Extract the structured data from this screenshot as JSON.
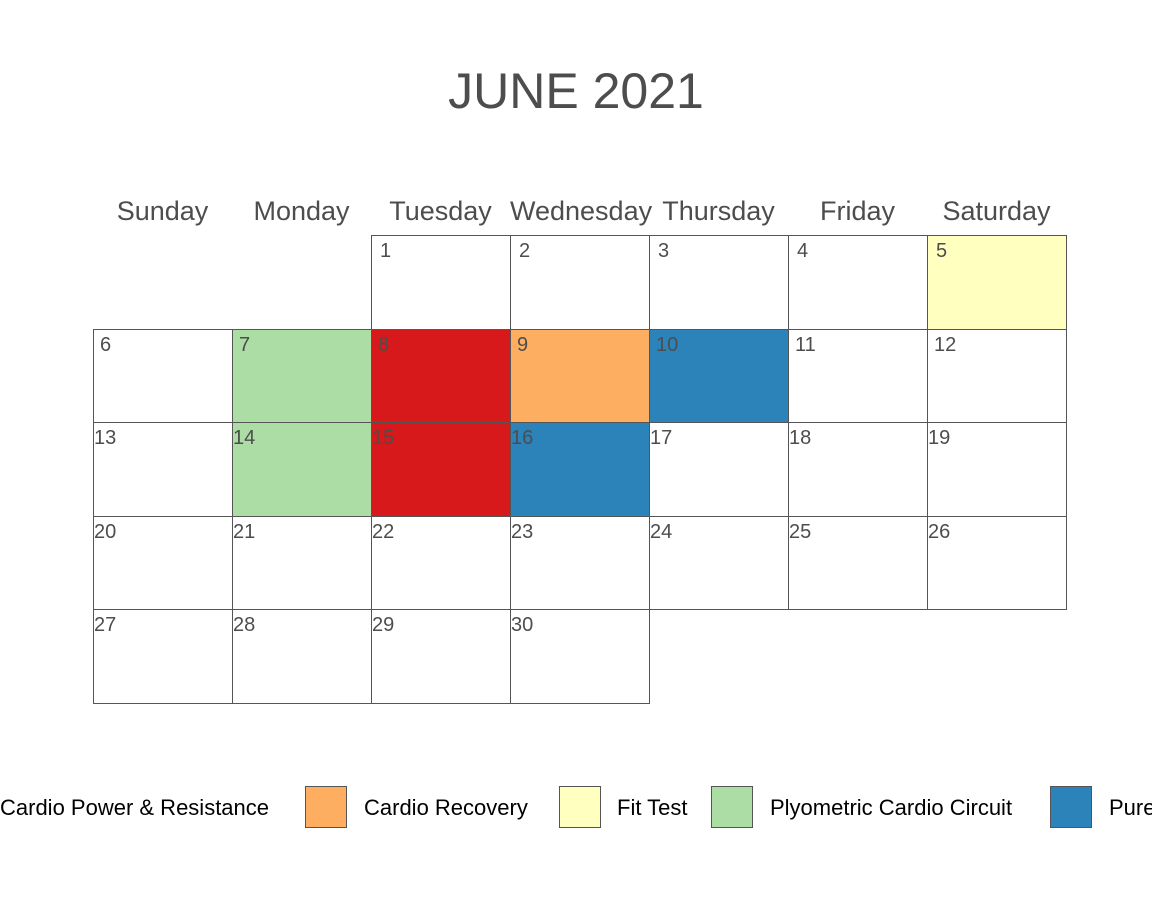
{
  "chart_data": {
    "type": "calendar",
    "title": "JUNE 2021",
    "weekdays": [
      "Sunday",
      "Monday",
      "Tuesday",
      "Wednesday",
      "Thursday",
      "Friday",
      "Saturday"
    ],
    "first_weekday_index": 2,
    "num_days": 30,
    "events": [
      {
        "day": 5,
        "category": "Fit Test"
      },
      {
        "day": 7,
        "category": "Plyometric Cardio Circuit"
      },
      {
        "day": 8,
        "category": "Cardio Power & Resistance"
      },
      {
        "day": 9,
        "category": "Cardio Recovery"
      },
      {
        "day": 10,
        "category": "Pure"
      },
      {
        "day": 14,
        "category": "Plyometric Cardio Circuit"
      },
      {
        "day": 15,
        "category": "Cardio Power & Resistance"
      },
      {
        "day": 16,
        "category": "Pure"
      }
    ],
    "legend": [
      {
        "label": "Cardio Power & Resistance",
        "color": "#d7191c"
      },
      {
        "label": "Cardio Recovery",
        "color": "#fdae61"
      },
      {
        "label": "Fit Test",
        "color": "#ffffbf"
      },
      {
        "label": "Plyometric Cardio Circuit",
        "color": "#abdda4"
      },
      {
        "label": "Pure",
        "color": "#2b83ba"
      }
    ],
    "legend_placement": "bottom"
  }
}
